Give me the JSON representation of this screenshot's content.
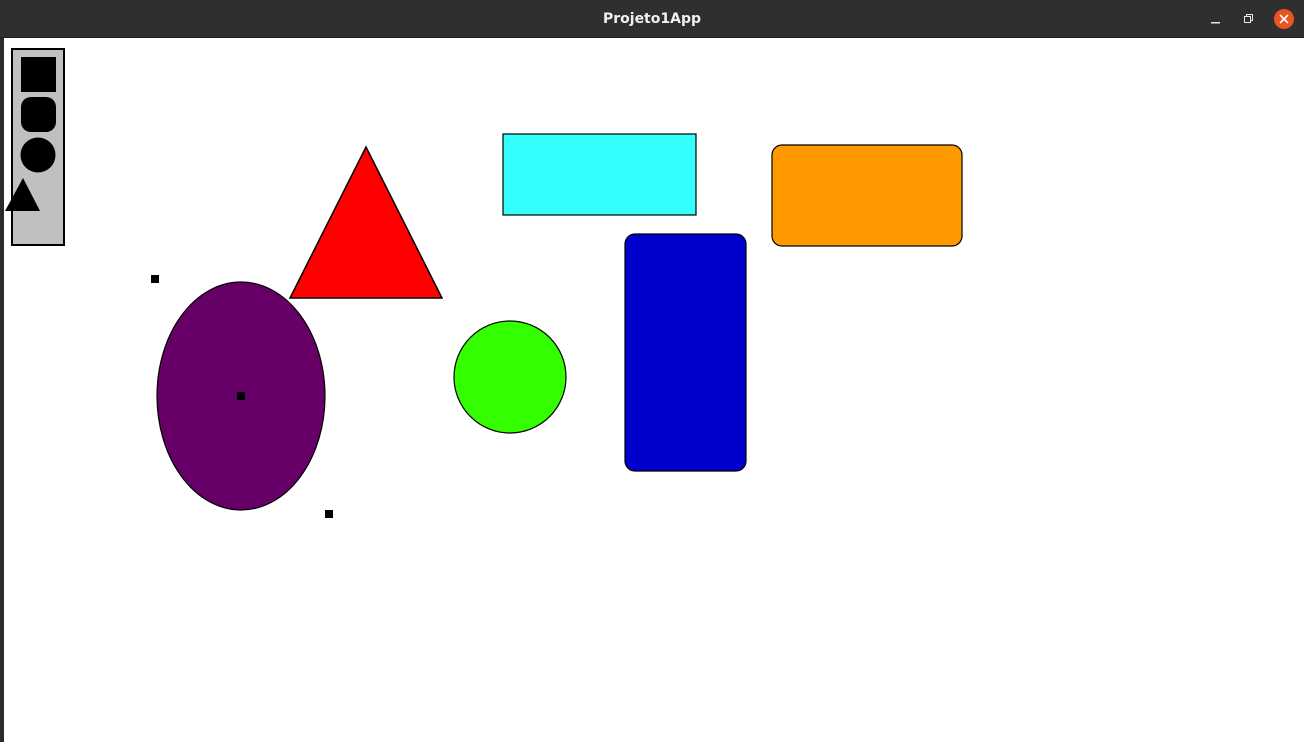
{
  "window": {
    "title": "Projeto1App",
    "controls": [
      "minimize",
      "maximize",
      "close"
    ],
    "close_color": "#e95420"
  },
  "toolbar": {
    "tools": [
      "rectangle-tool",
      "rounded-rectangle-tool",
      "circle-tool",
      "triangle-tool"
    ],
    "background": "#c0c0c0"
  },
  "shapes": [
    {
      "type": "triangle",
      "fill": "#ff0000"
    },
    {
      "type": "rectangle",
      "fill": "#33ffff"
    },
    {
      "type": "rounded-rectangle",
      "fill": "#ff9900"
    },
    {
      "type": "rounded-rectangle",
      "fill": "#0000cc"
    },
    {
      "type": "circle",
      "fill": "#33ff00"
    },
    {
      "type": "ellipse",
      "fill": "#660066",
      "selected": true
    }
  ]
}
